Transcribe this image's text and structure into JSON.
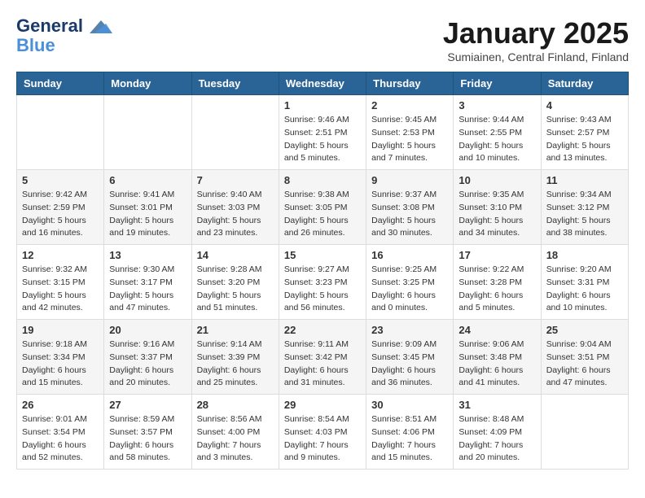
{
  "logo": {
    "line1": "General",
    "line2": "Blue"
  },
  "title": "January 2025",
  "subtitle": "Sumiainen, Central Finland, Finland",
  "weekdays": [
    "Sunday",
    "Monday",
    "Tuesday",
    "Wednesday",
    "Thursday",
    "Friday",
    "Saturday"
  ],
  "weeks": [
    [
      {
        "day": "",
        "content": ""
      },
      {
        "day": "",
        "content": ""
      },
      {
        "day": "",
        "content": ""
      },
      {
        "day": "1",
        "content": "Sunrise: 9:46 AM\nSunset: 2:51 PM\nDaylight: 5 hours\nand 5 minutes."
      },
      {
        "day": "2",
        "content": "Sunrise: 9:45 AM\nSunset: 2:53 PM\nDaylight: 5 hours\nand 7 minutes."
      },
      {
        "day": "3",
        "content": "Sunrise: 9:44 AM\nSunset: 2:55 PM\nDaylight: 5 hours\nand 10 minutes."
      },
      {
        "day": "4",
        "content": "Sunrise: 9:43 AM\nSunset: 2:57 PM\nDaylight: 5 hours\nand 13 minutes."
      }
    ],
    [
      {
        "day": "5",
        "content": "Sunrise: 9:42 AM\nSunset: 2:59 PM\nDaylight: 5 hours\nand 16 minutes."
      },
      {
        "day": "6",
        "content": "Sunrise: 9:41 AM\nSunset: 3:01 PM\nDaylight: 5 hours\nand 19 minutes."
      },
      {
        "day": "7",
        "content": "Sunrise: 9:40 AM\nSunset: 3:03 PM\nDaylight: 5 hours\nand 23 minutes."
      },
      {
        "day": "8",
        "content": "Sunrise: 9:38 AM\nSunset: 3:05 PM\nDaylight: 5 hours\nand 26 minutes."
      },
      {
        "day": "9",
        "content": "Sunrise: 9:37 AM\nSunset: 3:08 PM\nDaylight: 5 hours\nand 30 minutes."
      },
      {
        "day": "10",
        "content": "Sunrise: 9:35 AM\nSunset: 3:10 PM\nDaylight: 5 hours\nand 34 minutes."
      },
      {
        "day": "11",
        "content": "Sunrise: 9:34 AM\nSunset: 3:12 PM\nDaylight: 5 hours\nand 38 minutes."
      }
    ],
    [
      {
        "day": "12",
        "content": "Sunrise: 9:32 AM\nSunset: 3:15 PM\nDaylight: 5 hours\nand 42 minutes."
      },
      {
        "day": "13",
        "content": "Sunrise: 9:30 AM\nSunset: 3:17 PM\nDaylight: 5 hours\nand 47 minutes."
      },
      {
        "day": "14",
        "content": "Sunrise: 9:28 AM\nSunset: 3:20 PM\nDaylight: 5 hours\nand 51 minutes."
      },
      {
        "day": "15",
        "content": "Sunrise: 9:27 AM\nSunset: 3:23 PM\nDaylight: 5 hours\nand 56 minutes."
      },
      {
        "day": "16",
        "content": "Sunrise: 9:25 AM\nSunset: 3:25 PM\nDaylight: 6 hours\nand 0 minutes."
      },
      {
        "day": "17",
        "content": "Sunrise: 9:22 AM\nSunset: 3:28 PM\nDaylight: 6 hours\nand 5 minutes."
      },
      {
        "day": "18",
        "content": "Sunrise: 9:20 AM\nSunset: 3:31 PM\nDaylight: 6 hours\nand 10 minutes."
      }
    ],
    [
      {
        "day": "19",
        "content": "Sunrise: 9:18 AM\nSunset: 3:34 PM\nDaylight: 6 hours\nand 15 minutes."
      },
      {
        "day": "20",
        "content": "Sunrise: 9:16 AM\nSunset: 3:37 PM\nDaylight: 6 hours\nand 20 minutes."
      },
      {
        "day": "21",
        "content": "Sunrise: 9:14 AM\nSunset: 3:39 PM\nDaylight: 6 hours\nand 25 minutes."
      },
      {
        "day": "22",
        "content": "Sunrise: 9:11 AM\nSunset: 3:42 PM\nDaylight: 6 hours\nand 31 minutes."
      },
      {
        "day": "23",
        "content": "Sunrise: 9:09 AM\nSunset: 3:45 PM\nDaylight: 6 hours\nand 36 minutes."
      },
      {
        "day": "24",
        "content": "Sunrise: 9:06 AM\nSunset: 3:48 PM\nDaylight: 6 hours\nand 41 minutes."
      },
      {
        "day": "25",
        "content": "Sunrise: 9:04 AM\nSunset: 3:51 PM\nDaylight: 6 hours\nand 47 minutes."
      }
    ],
    [
      {
        "day": "26",
        "content": "Sunrise: 9:01 AM\nSunset: 3:54 PM\nDaylight: 6 hours\nand 52 minutes."
      },
      {
        "day": "27",
        "content": "Sunrise: 8:59 AM\nSunset: 3:57 PM\nDaylight: 6 hours\nand 58 minutes."
      },
      {
        "day": "28",
        "content": "Sunrise: 8:56 AM\nSunset: 4:00 PM\nDaylight: 7 hours\nand 3 minutes."
      },
      {
        "day": "29",
        "content": "Sunrise: 8:54 AM\nSunset: 4:03 PM\nDaylight: 7 hours\nand 9 minutes."
      },
      {
        "day": "30",
        "content": "Sunrise: 8:51 AM\nSunset: 4:06 PM\nDaylight: 7 hours\nand 15 minutes."
      },
      {
        "day": "31",
        "content": "Sunrise: 8:48 AM\nSunset: 4:09 PM\nDaylight: 7 hours\nand 20 minutes."
      },
      {
        "day": "",
        "content": ""
      }
    ]
  ]
}
